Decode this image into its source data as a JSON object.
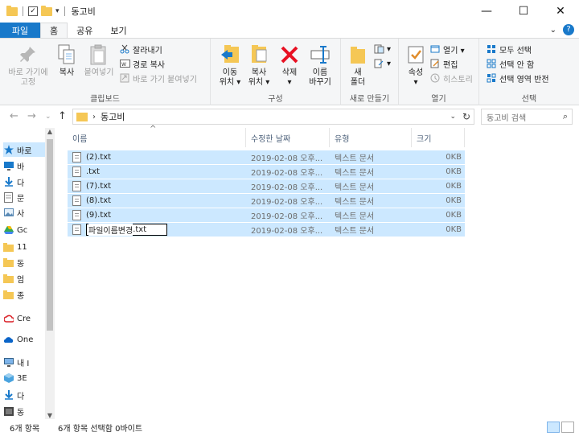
{
  "window": {
    "title": "동고비",
    "controls": {
      "minimize": "—",
      "maximize": "☐",
      "close": "✕"
    }
  },
  "tabs": [
    {
      "label": "파일"
    },
    {
      "label": "홈"
    },
    {
      "label": "공유"
    },
    {
      "label": "보기"
    }
  ],
  "ribbon": {
    "clipboard": {
      "label": "클립보드",
      "pin": "바로 가기에\n고정",
      "copy": "복사",
      "paste": "붙여넣기",
      "cut": "잘라내기",
      "copy_path": "경로 복사",
      "paste_shortcut": "바로 가기 붙여넣기"
    },
    "organize": {
      "label": "구성",
      "move_to": "이동\n위치 ▾",
      "copy_to": "복사\n위치 ▾",
      "delete": "삭제\n▾",
      "rename": "이름\n바꾸기"
    },
    "new": {
      "label": "새로 만들기",
      "new_folder": "새\n폴더"
    },
    "open": {
      "label": "열기",
      "properties": "속성\n▾",
      "open": "열기 ▾",
      "edit": "편집",
      "history": "히스토리"
    },
    "select": {
      "label": "선택",
      "select_all": "모두 선택",
      "select_none": "선택 안 함",
      "invert": "선택 영역 반전"
    }
  },
  "address": {
    "path": "동고비",
    "search_placeholder": "동고비 검색"
  },
  "navpane": [
    {
      "label": "바로",
      "icon": "star-icon",
      "selected": true
    },
    {
      "label": "바",
      "icon": "desktop-icon"
    },
    {
      "label": "다",
      "icon": "download-icon"
    },
    {
      "label": "문",
      "icon": "document-icon"
    },
    {
      "label": "사",
      "icon": "picture-icon"
    },
    {
      "label": "Gc",
      "icon": "drive-icon"
    },
    {
      "label": "11",
      "icon": "folder-icon"
    },
    {
      "label": "동",
      "icon": "folder-icon"
    },
    {
      "label": "엄",
      "icon": "folder-icon"
    },
    {
      "label": "종",
      "icon": "folder-icon"
    },
    {
      "label": "Cre",
      "icon": "creative-cloud-icon"
    },
    {
      "label": "One",
      "icon": "onedrive-icon"
    },
    {
      "label": "내 I",
      "icon": "pc-icon"
    },
    {
      "label": "3E",
      "icon": "cube-icon"
    },
    {
      "label": "다",
      "icon": "download-icon"
    },
    {
      "label": "동",
      "icon": "video-icon"
    }
  ],
  "columns": {
    "name": "이름",
    "date": "수정한 날짜",
    "type": "유형",
    "size": "크기"
  },
  "files": [
    {
      "name": "(2).txt",
      "date": "2019-02-08 오후...",
      "type": "텍스트 문서",
      "size": "0KB"
    },
    {
      "name": ".txt",
      "date": "2019-02-08 오후...",
      "type": "텍스트 문서",
      "size": "0KB"
    },
    {
      "name": "(7).txt",
      "date": "2019-02-08 오후...",
      "type": "텍스트 문서",
      "size": "0KB"
    },
    {
      "name": "(8).txt",
      "date": "2019-02-08 오후...",
      "type": "텍스트 문서",
      "size": "0KB"
    },
    {
      "name": "(9).txt",
      "date": "2019-02-08 오후...",
      "type": "텍스트 문서",
      "size": "0KB"
    }
  ],
  "renaming": {
    "base": "파일이름변경",
    "ext": ".txt",
    "date": "2019-02-08 오후...",
    "type": "텍스트 문서",
    "size": "0KB"
  },
  "status": {
    "count": "6개 항목",
    "selection": "6개 항목 선택함 0바이트"
  },
  "colors": {
    "accent": "#1979ca",
    "selection": "#cce8ff"
  }
}
